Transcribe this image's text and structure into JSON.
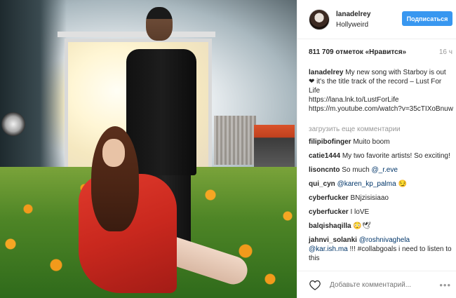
{
  "post": {
    "username": "lanadelrey",
    "location": "Hollyweird",
    "follow_label": "Подписаться",
    "likes": "811 709 отметок «Нравится»",
    "time": "16 ч",
    "caption_user": "lanadelrey",
    "caption_text": "My new song with Starboy is out ❤ it's the title track of the record – Lust For Life",
    "caption_link1": "https://lana.lnk.to/LustForLife",
    "caption_link2": "https://m.youtube.com/watch?v=35cTIXoBnuw",
    "load_more": "загрузить еще комментарии",
    "comments": [
      {
        "user": "filipibofinger",
        "text": "Muito boom"
      },
      {
        "user": "catie1444",
        "text": "My two favorite artists! So exciting!"
      },
      {
        "user": "lisoncnto",
        "text": "So much ",
        "mention": "@_r.eve"
      },
      {
        "user": "qui_cyn",
        "mention": "@karen_kp_palma",
        "text": " 😏"
      },
      {
        "user": "cyberfucker",
        "text": "BNjzisisiaao"
      },
      {
        "user": "cyberfucker",
        "text": "I loVE"
      },
      {
        "user": "balqishaqilla",
        "text": "😳🕊"
      },
      {
        "user": "jahnvi_solanki",
        "mention": "@roshnivaghela",
        "mention2": "@kar.ish.ma",
        "text": " !!! #collabgoals i need to listen to this"
      }
    ],
    "add_comment_placeholder": "Добавьте комментарий...",
    "more_label": "•••"
  },
  "colors": {
    "follow_button": "#3897f0",
    "mention": "#003569",
    "muted": "#999999"
  },
  "icons": {
    "like": "heart-icon",
    "more": "more-options-icon"
  }
}
